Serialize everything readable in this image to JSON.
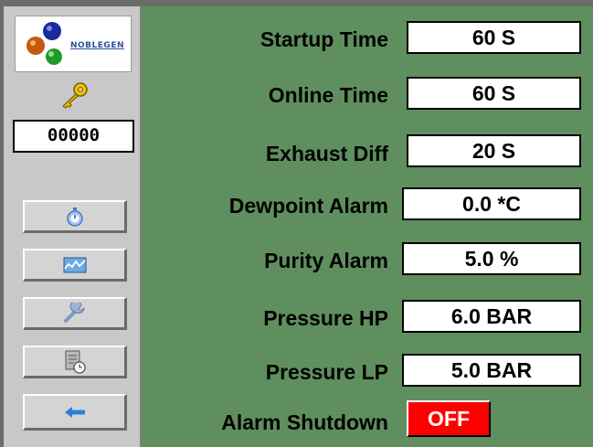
{
  "logo": {
    "text": "NOBLEGEN"
  },
  "sidebar": {
    "code": "00000",
    "buttons": [
      {
        "icon": "stopwatch-icon"
      },
      {
        "icon": "trend-chart-icon"
      },
      {
        "icon": "wrench-icon"
      },
      {
        "icon": "schedule-clock-icon"
      },
      {
        "icon": "back-arrow-icon"
      }
    ]
  },
  "settings": {
    "startup_time": {
      "label": "Startup Time",
      "value": "60 S"
    },
    "online_time": {
      "label": "Online Time",
      "value": "60 S"
    },
    "exhaust_diff": {
      "label": "Exhaust Diff",
      "value": "20 S"
    },
    "dewpoint_alarm": {
      "label": "Dewpoint Alarm",
      "value": "0.0 *C"
    },
    "purity_alarm": {
      "label": "Purity Alarm",
      "value": "5.0 %"
    },
    "pressure_hp": {
      "label": "Pressure HP",
      "value": "6.0 BAR"
    },
    "pressure_lp": {
      "label": "Pressure LP",
      "value": "5.0 BAR"
    },
    "alarm_shutdown": {
      "label": "Alarm Shutdown",
      "value": "OFF"
    }
  },
  "colors": {
    "background": "#5f8f5f",
    "sidebar": "#c8c8c8",
    "off_state": "#ff0000"
  }
}
